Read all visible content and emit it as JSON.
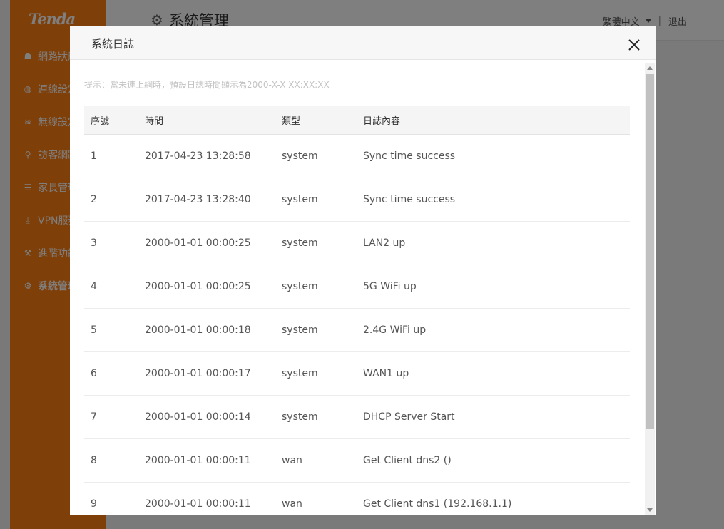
{
  "app": {
    "logo": "Tenda",
    "sidebar": {
      "items": [
        {
          "label": "網路狀態",
          "icon": "network-status-icon",
          "glyph": "☗"
        },
        {
          "label": "連線設定",
          "icon": "globe-icon",
          "glyph": "◍"
        },
        {
          "label": "無線設定",
          "icon": "wifi-icon",
          "glyph": "≋"
        },
        {
          "label": "訪客網路",
          "icon": "guest-network-icon",
          "glyph": "⚲"
        },
        {
          "label": "家長管理",
          "icon": "parental-control-icon",
          "glyph": "☰"
        },
        {
          "label": "VPN服務",
          "icon": "vpn-icon",
          "glyph": "⤓"
        },
        {
          "label": "進階功能",
          "icon": "wrench-icon",
          "glyph": "⚒"
        },
        {
          "label": "系統管理",
          "icon": "gear-icon",
          "glyph": "⚙",
          "active": true
        }
      ]
    },
    "header": {
      "title": "系統管理",
      "language": "繁體中文",
      "logout": "退出"
    }
  },
  "modal": {
    "title": "系統日誌",
    "hint": "提示：當未連上網時，預設日誌時間顯示為2000-X-X XX:XX:XX",
    "columns": [
      "序號",
      "時間",
      "類型",
      "日誌內容"
    ],
    "rows": [
      [
        "1",
        "2017-04-23 13:28:58",
        "system",
        "Sync time success"
      ],
      [
        "2",
        "2017-04-23 13:28:40",
        "system",
        "Sync time success"
      ],
      [
        "3",
        "2000-01-01 00:00:25",
        "system",
        "LAN2 up"
      ],
      [
        "4",
        "2000-01-01 00:00:25",
        "system",
        "5G WiFi up"
      ],
      [
        "5",
        "2000-01-01 00:00:18",
        "system",
        "2.4G WiFi up"
      ],
      [
        "6",
        "2000-01-01 00:00:17",
        "system",
        "WAN1 up"
      ],
      [
        "7",
        "2000-01-01 00:00:14",
        "system",
        "DHCP Server Start"
      ],
      [
        "8",
        "2000-01-01 00:00:11",
        "wan",
        "Get Client dns2 ()"
      ],
      [
        "9",
        "2000-01-01 00:00:11",
        "wan",
        "Get Client dns1 (192.168.1.1)"
      ]
    ]
  },
  "colors": {
    "brand": "#ff7e12",
    "overlay": "rgba(0,0,0,0.5)"
  }
}
